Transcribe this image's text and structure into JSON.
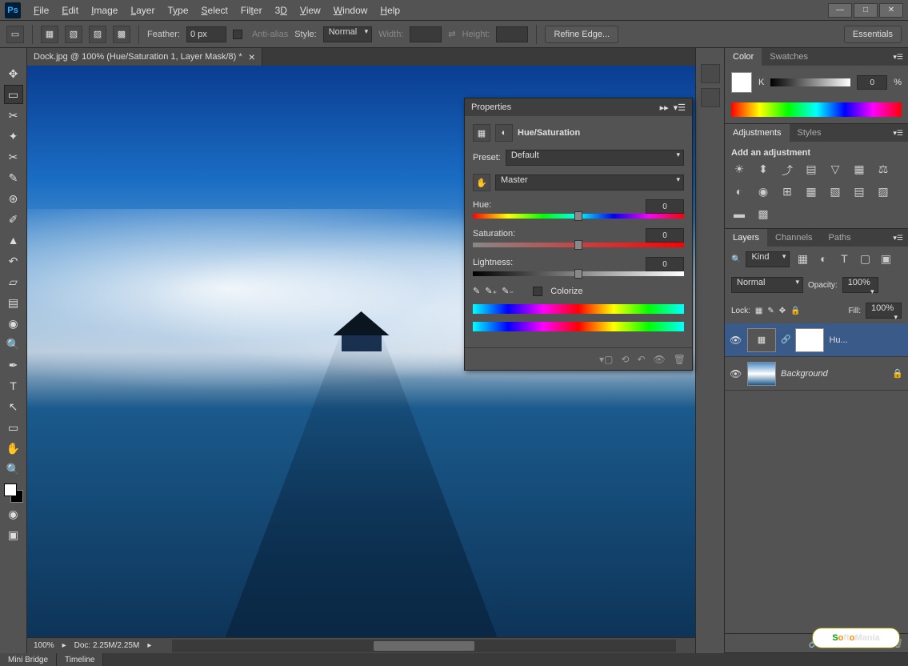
{
  "menus": [
    "File",
    "Edit",
    "Image",
    "Layer",
    "Type",
    "Select",
    "Filter",
    "3D",
    "View",
    "Window",
    "Help"
  ],
  "menu_underline": [
    "F",
    "E",
    "I",
    "L",
    "T",
    "S",
    "F",
    "3",
    "V",
    "W",
    "H"
  ],
  "optionbar": {
    "feather_label": "Feather:",
    "feather_value": "0 px",
    "antialias": "Anti-alias",
    "style_label": "Style:",
    "style_value": "Normal",
    "width_label": "Width:",
    "height_label": "Height:",
    "refine": "Refine Edge...",
    "essentials": "Essentials"
  },
  "doc_tab": "Dock.jpg @ 100% (Hue/Saturation 1, Layer Mask/8) *",
  "status": {
    "zoom": "100%",
    "doc": "Doc: 2.25M/2.25M"
  },
  "bottom_tabs": [
    "Mini Bridge",
    "Timeline"
  ],
  "color_panel": {
    "tab1": "Color",
    "tab2": "Swatches",
    "channel": "K",
    "value": "0",
    "unit": "%"
  },
  "adjustments": {
    "tab1": "Adjustments",
    "tab2": "Styles",
    "heading": "Add an adjustment"
  },
  "layers": {
    "tab1": "Layers",
    "tab2": "Channels",
    "tab3": "Paths",
    "filter_label": "Kind",
    "blend": "Normal",
    "opacity_label": "Opacity:",
    "opacity_value": "100%",
    "lock_label": "Lock:",
    "fill_label": "Fill:",
    "fill_value": "100%",
    "layer1": "Hu...",
    "layer2": "Background"
  },
  "properties": {
    "title": "Properties",
    "adj_name": "Hue/Saturation",
    "preset_label": "Preset:",
    "preset_value": "Default",
    "channel_value": "Master",
    "hue_label": "Hue:",
    "hue_value": "0",
    "sat_label": "Saturation:",
    "sat_value": "0",
    "light_label": "Lightness:",
    "light_value": "0",
    "colorize": "Colorize"
  },
  "watermark": "SoftoMania"
}
